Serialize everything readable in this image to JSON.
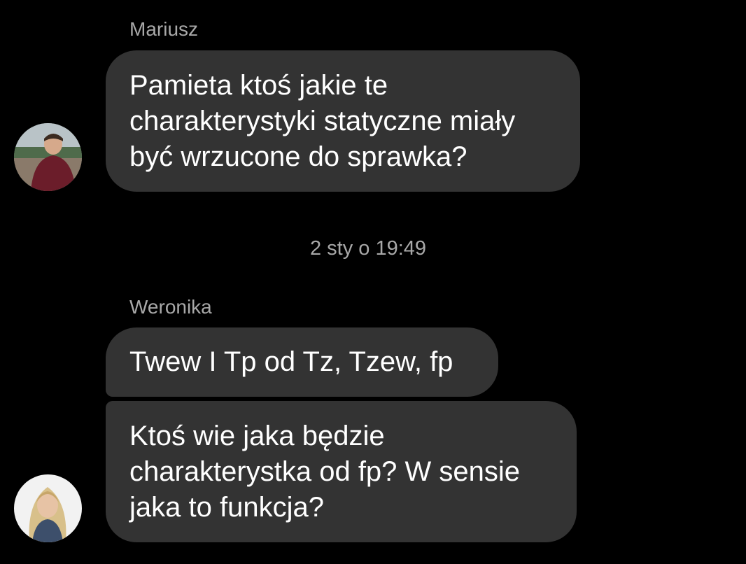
{
  "messages": [
    {
      "sender": "Mariusz",
      "text": "Pamieta ktoś jakie te\ncharakterystyki statyczne miały\nbyć wrzucone do sprawka?"
    }
  ],
  "timestamp": "2 sty o 19:49",
  "second_group": {
    "sender": "Weronika",
    "messages": [
      {
        "text": "Twew I Tp od Tz, Tzew, fp"
      },
      {
        "text": "Ktoś wie jaka będzie\ncharakterystka od fp? W sensie\njaka to funkcja?"
      }
    ]
  },
  "colors": {
    "background": "#000000",
    "bubble": "#333333",
    "secondary_text": "#a8a8a8",
    "message_text": "#ffffff"
  }
}
